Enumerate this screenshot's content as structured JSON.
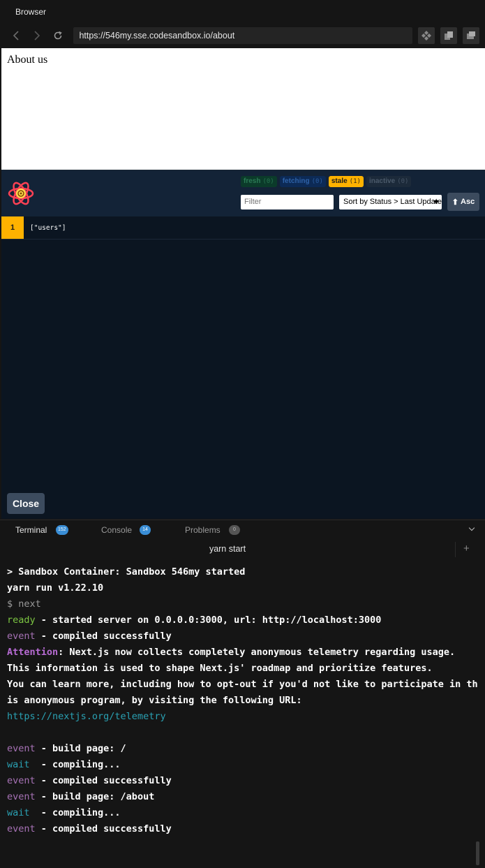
{
  "window": {
    "title": "Browser"
  },
  "browser": {
    "url": "https://546my.sse.codesandbox.io/about"
  },
  "preview": {
    "heading": "About us"
  },
  "devtools": {
    "badges": [
      {
        "label": "fresh",
        "count": "(0)"
      },
      {
        "label": "fetching",
        "count": "(0)"
      },
      {
        "label": "stale",
        "count": "(1)"
      },
      {
        "label": "inactive",
        "count": "(0)"
      }
    ],
    "filter_placeholder": "Filter",
    "sort_label": "Sort by Status > Last Updated",
    "asc_label": "Asc",
    "queries": [
      {
        "count": "1",
        "key": "[\"users\"]"
      }
    ],
    "close_label": "Close",
    "colors": {
      "stale": "#ffb200",
      "panel_bg": "#0b1521",
      "header_bg": "#132337"
    }
  },
  "panel": {
    "tabs": [
      {
        "label": "Terminal",
        "badge": "152"
      },
      {
        "label": "Console",
        "badge": "14"
      },
      {
        "label": "Problems",
        "badge": "0"
      }
    ],
    "terminal_title": "yarn start"
  },
  "terminal": {
    "line1": "> Sandbox Container: Sandbox 546my started",
    "line2": "yarn run v1.22.10",
    "line3": "$ next",
    "line4_tag": "ready",
    "line4_text": " - started server on 0.0.0.0:3000, url: http://localhost:3000",
    "line5_tag": "event",
    "line5_text": " - compiled successfully",
    "line6_tag": "Attention",
    "line6_text": ": Next.js now collects completely anonymous telemetry regarding usage.",
    "line7": "This information is used to shape Next.js' roadmap and prioritize features.",
    "line8": "You can learn more, including how to opt-out if you'd not like to participate in th",
    "line9": "is anonymous program, by visiting the following URL:",
    "line10": "https://nextjs.org/telemetry",
    "line12_tag": "event",
    "line12_text": " - build page: /",
    "line13_tag": "wait",
    "line13_text": "  - compiling...",
    "line14_tag": "event",
    "line14_text": " - compiled successfully",
    "line15_tag": "event",
    "line15_text": " - build page: /about",
    "line16_tag": "wait",
    "line16_text": "  - compiling...",
    "line17_tag": "event",
    "line17_text": " - compiled successfully"
  }
}
